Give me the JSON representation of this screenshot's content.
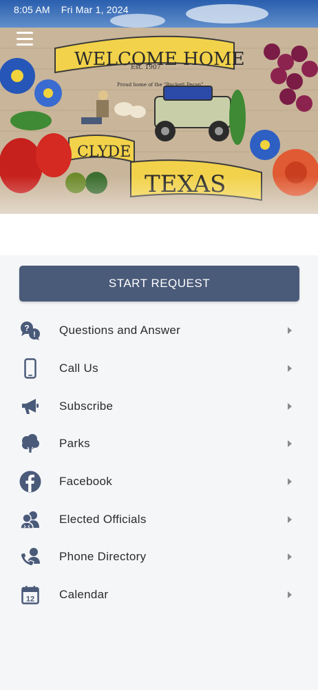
{
  "status_bar": {
    "time": "8:05 AM",
    "date": "Fri Mar 1, 2024"
  },
  "hero": {
    "mural_text_1": "WELCOME HOME",
    "mural_text_2": "Est. 1907",
    "mural_text_3": "Proud home of the \"Buckett Pecan\"",
    "mural_text_4": "CLYDE",
    "mural_text_5": "TEXAS"
  },
  "start_request": {
    "label": "START REQUEST"
  },
  "menu": {
    "items": [
      {
        "label": "Questions and Answer",
        "icon": "questions-icon"
      },
      {
        "label": "Call Us",
        "icon": "mobile-phone-icon"
      },
      {
        "label": "Subscribe",
        "icon": "megaphone-icon"
      },
      {
        "label": "Parks",
        "icon": "tree-icon"
      },
      {
        "label": "Facebook",
        "icon": "facebook-icon"
      },
      {
        "label": "Elected Officials",
        "icon": "officials-icon"
      },
      {
        "label": "Phone Directory",
        "icon": "phone-directory-icon"
      },
      {
        "label": "Calendar",
        "icon": "calendar-icon"
      }
    ]
  },
  "colors": {
    "accent": "#4a5a79",
    "background": "#f5f6f8",
    "text": "#2b2b2b",
    "chevron": "#8b8b8b"
  }
}
